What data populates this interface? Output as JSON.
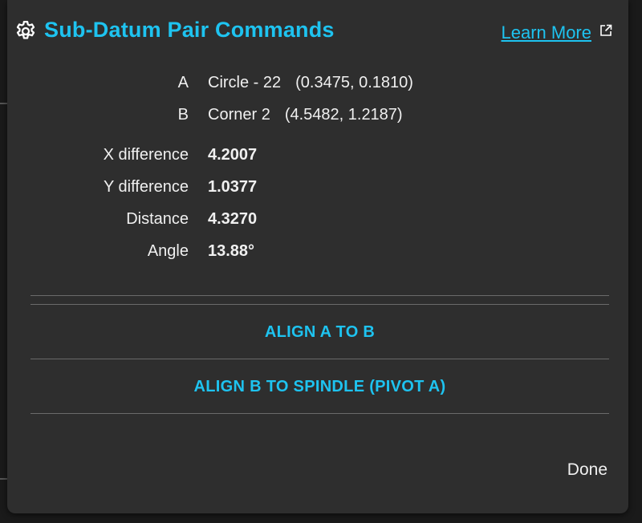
{
  "dialog": {
    "title": "Sub-Datum Pair Commands",
    "learn_more": "Learn More",
    "icon": "gear-icon",
    "link_icon": "external-link-icon"
  },
  "points": [
    {
      "label": "A",
      "name": "Circle - 22",
      "coords": "(0.3475, 0.1810)"
    },
    {
      "label": "B",
      "name": "Corner 2",
      "coords": "(4.5482, 1.2187)"
    }
  ],
  "measurements": [
    {
      "label": "X difference",
      "value": "4.2007"
    },
    {
      "label": "Y difference",
      "value": "1.0377"
    },
    {
      "label": "Distance",
      "value": "4.3270"
    },
    {
      "label": "Angle",
      "value": "13.88°"
    }
  ],
  "actions": {
    "align_a_to_b": "ALIGN A TO B",
    "align_b_to_spindle": "ALIGN B TO SPINDLE (PIVOT A)"
  },
  "footer": {
    "done": "Done"
  },
  "colors": {
    "accent": "#1ec3f0",
    "dialog_bg": "#2e2e2e",
    "text": "#f0f0f0"
  }
}
